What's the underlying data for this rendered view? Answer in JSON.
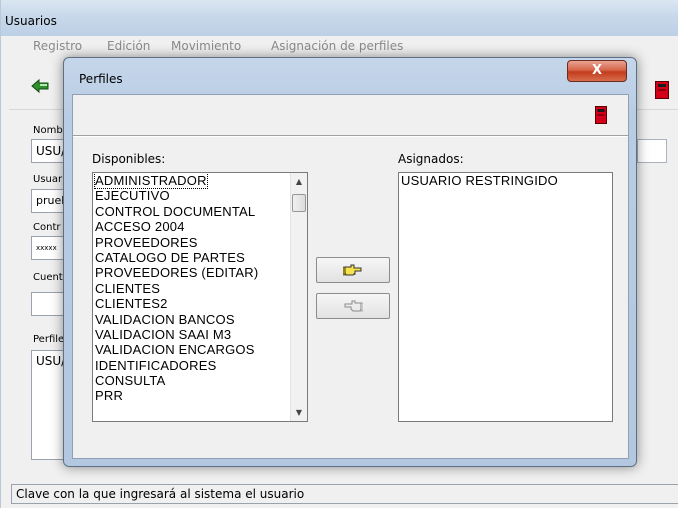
{
  "main_window": {
    "title": "Usuarios",
    "menu": [
      "Registro",
      "Edición",
      "Movimiento",
      "Asignación de perfiles"
    ],
    "labels": {
      "nombre": "Nomb",
      "usuario": "Usuar",
      "contrasena": "Contr",
      "cuenta": "Cuent",
      "perfiles": "Perfile"
    },
    "fields": {
      "nombre": "USU/",
      "usuario": "prueb",
      "contrasena": "xxxxx",
      "cuenta": ""
    },
    "perfiles_value": "USU/",
    "status": "Clave con la que ingresará al sistema el usuario"
  },
  "dialog": {
    "title": "Perfiles",
    "close_label": "X",
    "disponibles_label": "Disponibles:",
    "asignados_label": "Asignados:",
    "disponibles": [
      "ADMINISTRADOR",
      "EJECUTIVO",
      "CONTROL DOCUMENTAL",
      "ACCESO 2004",
      "PROVEEDORES",
      "CATALOGO DE PARTES",
      "PROVEEDORES (EDITAR)",
      "CLIENTES",
      "CLIENTES2",
      "VALIDACION BANCOS",
      "VALIDACION SAAI M3",
      "VALIDACION ENCARGOS",
      "IDENTIFICADORES",
      "CONSULTA",
      "PRR"
    ],
    "asignados": [
      "USUARIO RESTRINGIDO"
    ]
  },
  "icons": {
    "back": "back-arrow-icon",
    "exit": "exit-door-icon",
    "assign": "pointing-hand-right-icon",
    "remove": "pointing-hand-left-icon"
  },
  "colors": {
    "dialog_frame": "#b8cce3",
    "close_button": "#c23c1d",
    "exit_icon": "#d4001a"
  }
}
